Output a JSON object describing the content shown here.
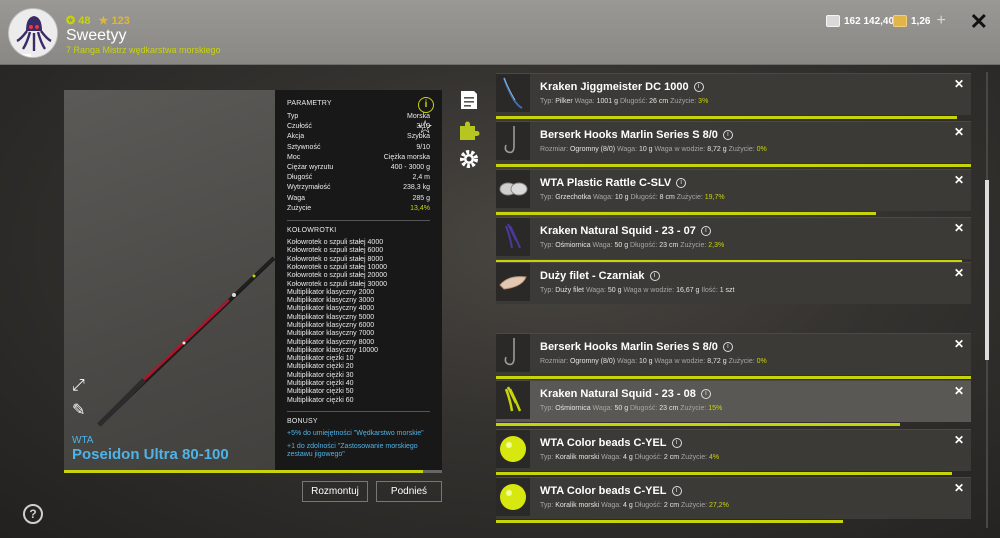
{
  "header": {
    "level": "48",
    "rank_points": "123",
    "username": "Sweetyy",
    "rank_title": "7 Ranga Mistrz wędkarstwa morskiego",
    "silver": "162 142,40",
    "gold": "1,26",
    "plus_label": "+"
  },
  "rod": {
    "brand": "WTA",
    "name": "Poseidon Ultra 80-100",
    "wear_fraction": 0.95,
    "params_title": "PARAMETRY",
    "params": [
      {
        "k": "Typ",
        "v": "Morska"
      },
      {
        "k": "Czułość",
        "v": "3/10"
      },
      {
        "k": "Akcja",
        "v": "Szybka"
      },
      {
        "k": "Sztywność",
        "v": "9/10"
      },
      {
        "k": "Moc",
        "v": "Ciężka morska"
      },
      {
        "k": "Ciężar wyrzutu",
        "v": "400 - 3000 g"
      },
      {
        "k": "Długość",
        "v": "2,4 m"
      },
      {
        "k": "Wytrzymałość",
        "v": "238,3 kg"
      },
      {
        "k": "Waga",
        "v": "285 g"
      },
      {
        "k": "Zużycie",
        "v": "13,4%"
      }
    ],
    "reels_title": "KOŁOWROTKI",
    "reels": [
      "Kołowrotek o szpuli stałej 4000",
      "Kołowrotek o szpuli stałej 6000",
      "Kołowrotek o szpuli stałej 8000",
      "Kołowrotek o szpuli stałej 10000",
      "Kołowrotek o szpuli stałej 20000",
      "Kołowrotek o szpuli stałej 30000",
      "Multiplikator klasyczny 2000",
      "Multiplikator klasyczny 3000",
      "Multiplikator klasyczny 4000",
      "Multiplikator klasyczny 5000",
      "Multiplikator klasyczny 6000",
      "Multiplikator klasyczny 7000",
      "Multiplikator klasyczny 8000",
      "Multiplikator klasyczny 10000",
      "Multiplikator ciężki 10",
      "Multiplikator ciężki 20",
      "Multiplikator ciężki 30",
      "Multiplikator ciężki 40",
      "Multiplikator ciężki 50",
      "Multiplikator ciężki 60"
    ],
    "bonus_title": "BONUSY",
    "bonuses": [
      "+5% do umiejętności \"Wędkarstwo morskie\"",
      "+1 do zdolności \"Zastosowanie morskiego zestawu jigowego\""
    ],
    "btn_unmount": "Rozmontuj",
    "btn_lift": "Podnieś"
  },
  "items": [
    {
      "name": "Kraken Jiggmeister DC 1000",
      "meta": [
        [
          "Typ",
          "Pilker"
        ],
        [
          "Waga",
          "1001 g"
        ],
        [
          "Długość",
          "26 cm"
        ],
        [
          "Zużycie",
          "3%"
        ]
      ],
      "bar": 0.97,
      "thumb": "jig-icon",
      "highlight": false
    },
    {
      "name": "Berserk Hooks Marlin Series S 8/0",
      "meta": [
        [
          "Rozmiar",
          "Ogromny (8/0)"
        ],
        [
          "Waga",
          "10 g"
        ],
        [
          "Waga w wodzie",
          "8,72 g"
        ],
        [
          "Zużycie",
          "0%"
        ]
      ],
      "bar": 1.0,
      "thumb": "hook-icon",
      "highlight": false
    },
    {
      "name": "WTA Plastic Rattle C-SLV",
      "meta": [
        [
          "Typ",
          "Grzechotka"
        ],
        [
          "Waga",
          "10 g"
        ],
        [
          "Długość",
          "8 cm"
        ],
        [
          "Zużycie",
          "19,7%"
        ]
      ],
      "bar": 0.8,
      "thumb": "rattle-icon",
      "highlight": false
    },
    {
      "name": "Kraken Natural Squid - 23 - 07",
      "meta": [
        [
          "Typ",
          "Ośmiornica"
        ],
        [
          "Waga",
          "50 g"
        ],
        [
          "Długość",
          "23 cm"
        ],
        [
          "Zużycie",
          "2,3%"
        ]
      ],
      "bar": 0.98,
      "thumb": "squid-icon",
      "highlight": false
    },
    {
      "name": "Duży filet - Czarniak",
      "meta": [
        [
          "Typ",
          "Duży filet"
        ],
        [
          "Waga",
          "50 g"
        ],
        [
          "Waga w wodzie",
          "16,67 g"
        ],
        [
          "Ilość",
          "1 szt"
        ]
      ],
      "bar": 0,
      "thumb": "fillet-icon",
      "highlight": false
    },
    {
      "name": "Berserk Hooks Marlin Series S 8/0",
      "meta": [
        [
          "Rozmiar",
          "Ogromny (8/0)"
        ],
        [
          "Waga",
          "10 g"
        ],
        [
          "Waga w wodzie",
          "8,72 g"
        ],
        [
          "Zużycie",
          "0%"
        ]
      ],
      "bar": 1.0,
      "thumb": "hook-icon",
      "highlight": false
    },
    {
      "name": "Kraken Natural Squid - 23 - 08",
      "meta": [
        [
          "Typ",
          "Ośmiornica"
        ],
        [
          "Waga",
          "50 g"
        ],
        [
          "Długość",
          "23 cm"
        ],
        [
          "Zużycie",
          "15%"
        ]
      ],
      "bar": 0.85,
      "thumb": "squid-yellow-icon",
      "highlight": true
    },
    {
      "name": "WTA Color beads C-YEL",
      "meta": [
        [
          "Typ",
          "Koralik morski"
        ],
        [
          "Waga",
          "4 g"
        ],
        [
          "Długość",
          "2 cm"
        ],
        [
          "Zużycie",
          "4%"
        ]
      ],
      "bar": 0.96,
      "thumb": "bead-icon",
      "highlight": false
    },
    {
      "name": "WTA Color beads C-YEL",
      "meta": [
        [
          "Typ",
          "Koralik morski"
        ],
        [
          "Waga",
          "4 g"
        ],
        [
          "Długość",
          "2 cm"
        ],
        [
          "Zużycie",
          "27,2%"
        ]
      ],
      "bar": 0.73,
      "thumb": "bead-icon",
      "highlight": false
    }
  ],
  "colors": {
    "accent": "#c8d40a",
    "blue": "#4fb3e8"
  }
}
